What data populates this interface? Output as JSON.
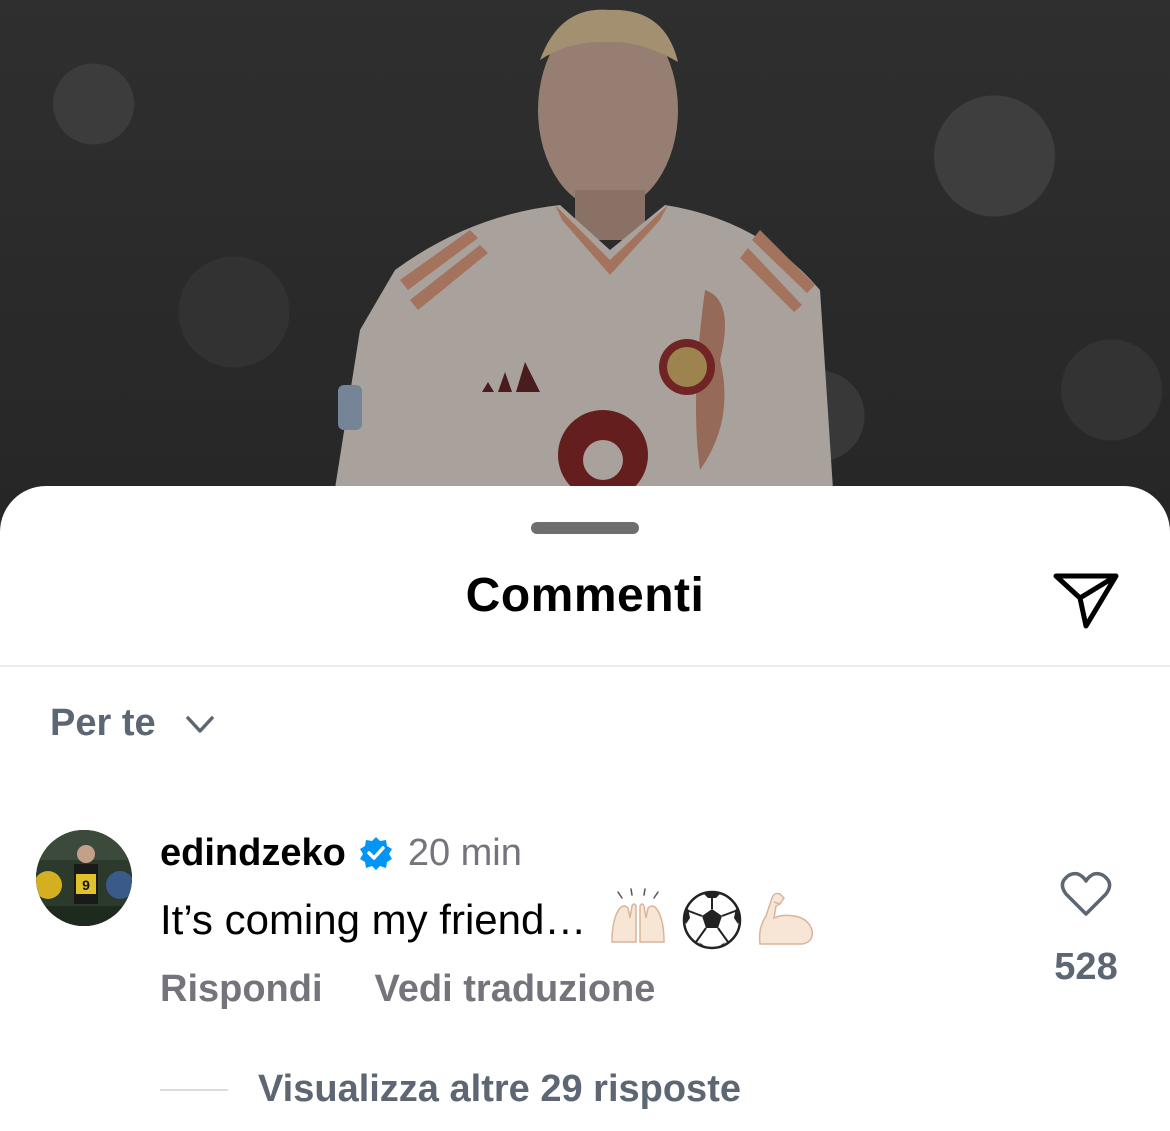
{
  "sheet": {
    "title": "Commenti",
    "filter_label": "Per te"
  },
  "comment": {
    "username": "edindzeko",
    "time": "20 min",
    "text": "It’s coming my friend…",
    "emojis": [
      "raising-hands-icon",
      "soccer-ball-icon",
      "flexed-biceps-icon"
    ],
    "reply_label": "Rispondi",
    "translate_label": "Vedi traduzione",
    "like_count": "528",
    "view_replies_label": "Visualizza altre 29 risposte",
    "avatar_jersey_number": "9"
  },
  "colors": {
    "verified_blue": "#0095f6",
    "secondary_text": "#74747c",
    "jersey": "#e8dcd2",
    "jersey_stripes": "#e09a78"
  }
}
